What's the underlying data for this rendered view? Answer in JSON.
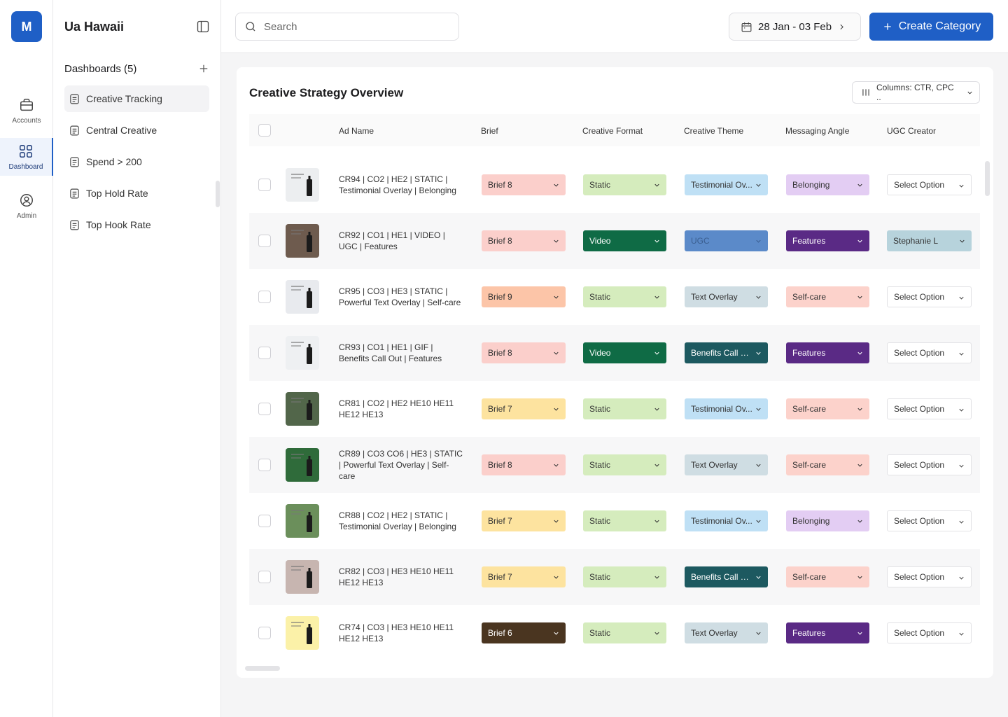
{
  "app": {
    "logo_letter": "M",
    "org_name": "Ua Hawaii"
  },
  "rail": [
    {
      "label": "Accounts",
      "icon": "briefcase-icon"
    },
    {
      "label": "Dashboard",
      "icon": "grid-icon"
    },
    {
      "label": "Admin",
      "icon": "user-circle-icon"
    }
  ],
  "sidebar": {
    "section_title": "Dashboards (5)",
    "items": [
      {
        "label": "Creative Tracking",
        "active": true
      },
      {
        "label": "Central Creative",
        "active": false
      },
      {
        "label": "Spend > 200",
        "active": false
      },
      {
        "label": "Top Hold Rate",
        "active": false
      },
      {
        "label": "Top Hook Rate",
        "active": false
      }
    ]
  },
  "topbar": {
    "search_placeholder": "Search",
    "date_range": "28 Jan - 03 Feb",
    "create_label": "Create Category"
  },
  "card": {
    "title": "Creative Strategy Overview",
    "columns_label": "Columns: CTR, CPC ..",
    "headers": [
      "Ad Name",
      "Brief",
      "Creative Format",
      "Creative Theme",
      "Messaging Angle",
      "UGC Creator"
    ]
  },
  "colors": {
    "accent": "#1f5fc6",
    "brief_8": "#fbcfcb",
    "brief_9": "#fcc5a8",
    "brief_7": "#fde39f",
    "brief_6": "#4a3520",
    "static": "#d5ecbd",
    "video": "#0f6b45",
    "testimonial": "#bfe0f5",
    "ugc_theme": "#5b8ac9",
    "text_overlay": "#cfdde3",
    "benefits": "#1d5960",
    "belonging": "#e3cdf3",
    "features": "#5a2a85",
    "selfcare": "#fcd2cb",
    "stephanie": "#b7d3dc"
  },
  "rows": [
    {
      "ad_name": "CR94 | CO2 | HE2 | STATIC | Testimonial Overlay | Belonging",
      "brief": "Brief 8",
      "format": "Static",
      "theme": "Testimonial Ov...",
      "angle": "Belonging",
      "creator": "Select Option"
    },
    {
      "ad_name": "CR92 | CO1 | HE1 | VIDEO | UGC | Features",
      "brief": "Brief 8",
      "format": "Video",
      "theme": "UGC",
      "angle": "Features",
      "creator": "Stephanie L"
    },
    {
      "ad_name": "CR95 | CO3 | HE3 | STATIC | Powerful Text Overlay | Self-care",
      "brief": "Brief 9",
      "format": "Static",
      "theme": "Text Overlay",
      "angle": "Self-care",
      "creator": "Select Option"
    },
    {
      "ad_name": "CR93 | CO1 | HE1 | GIF | Benefits Call Out | Features",
      "brief": "Brief 8",
      "format": "Video",
      "theme": "Benefits Call O...",
      "angle": "Features",
      "creator": "Select Option"
    },
    {
      "ad_name": "CR81 | CO2 | HE2 HE10 HE11 HE12 HE13",
      "brief": "Brief 7",
      "format": "Static",
      "theme": "Testimonial Ov...",
      "angle": "Self-care",
      "creator": "Select Option"
    },
    {
      "ad_name": "CR89 | CO3 CO6 | HE3 | STATIC | Powerful Text Overlay | Self-care",
      "brief": "Brief 8",
      "format": "Static",
      "theme": "Text Overlay",
      "angle": "Self-care",
      "creator": "Select Option"
    },
    {
      "ad_name": "CR88 | CO2 | HE2 | STATIC | Testimonial Overlay | Belonging",
      "brief": "Brief 7",
      "format": "Static",
      "theme": "Testimonial Ov...",
      "angle": "Belonging",
      "creator": "Select Option"
    },
    {
      "ad_name": "CR82 | CO3 | HE3 HE10 HE11 HE12 HE13",
      "brief": "Brief 7",
      "format": "Static",
      "theme": "Benefits Call O...",
      "angle": "Self-care",
      "creator": "Select Option"
    },
    {
      "ad_name": "CR74 | CO3 | HE3 HE10 HE11 HE12 HE13",
      "brief": "Brief 6",
      "format": "Static",
      "theme": "Text Overlay",
      "angle": "Features",
      "creator": "Select Option"
    }
  ]
}
